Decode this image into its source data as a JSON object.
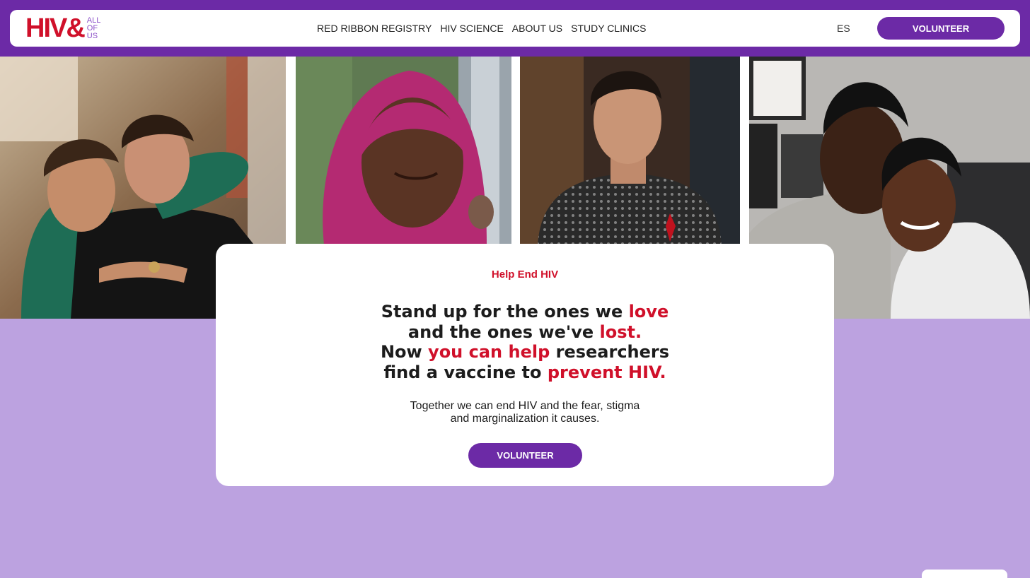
{
  "header": {
    "logo": {
      "main": "HIV&",
      "sub_lines": [
        "ALL",
        "OF",
        "US"
      ]
    },
    "nav": [
      {
        "label": "RED RIBBON REGISTRY"
      },
      {
        "label": "HIV SCIENCE"
      },
      {
        "label": "ABOUT US"
      },
      {
        "label": "STUDY CLINICS"
      }
    ],
    "language_toggle": "ES",
    "volunteer_label": "VOLUNTEER"
  },
  "colors": {
    "brand_purple": "#6c2aa6",
    "brand_red": "#d0102a",
    "page_lavender": "#bca2e0"
  },
  "photos": [
    {
      "subject": "two men embracing indoors"
    },
    {
      "subject": "smiling woman in magenta hijab"
    },
    {
      "subject": "man wearing red ribbon pin"
    },
    {
      "subject": "smiling couple cheek to cheek"
    }
  ],
  "hero": {
    "eyebrow": "Help End HIV",
    "headline_lines": [
      [
        {
          "text": "Stand up for the ones we ",
          "red": false
        },
        {
          "text": "love",
          "red": true
        }
      ],
      [
        {
          "text": "and the ones we've ",
          "red": false
        },
        {
          "text": "lost.",
          "red": true
        }
      ],
      [
        {
          "text": "Now ",
          "red": false
        },
        {
          "text": "you can help",
          "red": true
        },
        {
          "text": " researchers",
          "red": false
        }
      ],
      [
        {
          "text": "find a vaccine to ",
          "red": false
        },
        {
          "text": "prevent HIV.",
          "red": true
        }
      ]
    ],
    "subtext_lines": [
      "Together we can end HIV and the fear, stigma",
      "and marginalization it causes."
    ],
    "cta_label": "VOLUNTEER"
  }
}
